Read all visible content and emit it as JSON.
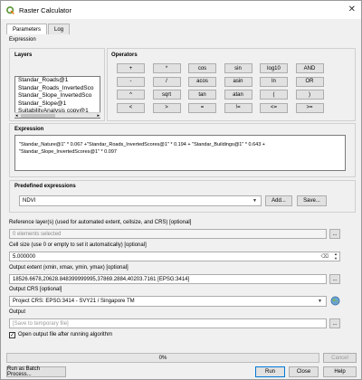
{
  "window": {
    "title": "Raster Calculator",
    "close_glyph": "✕"
  },
  "tabs": [
    {
      "label": "Parameters"
    },
    {
      "label": "Log"
    }
  ],
  "expression_header": "Expression",
  "layers": {
    "title": "Layers",
    "items": [
      "Standar_Roads@1",
      "Standar_Roads_InvertedSco",
      "Standar_Slope_InvertedSco",
      "Standar_Slope@1",
      "SuitabilityAnalysis copy@1"
    ]
  },
  "operators": {
    "title": "Operators",
    "rows": [
      [
        "+",
        "*",
        "cos",
        "sin",
        "log10",
        "AND"
      ],
      [
        "-",
        "/",
        "acos",
        "asin",
        "ln",
        "OR"
      ],
      [
        "^",
        "sqrt",
        "tan",
        "atan",
        "(",
        ")"
      ],
      [
        "<",
        ">",
        "=",
        "!=",
        "<=",
        ">="
      ]
    ]
  },
  "expression": {
    "title": "Expression",
    "text": "\"Standar_Nature@1\" * 0.067 +\"Standar_Roads_InvertedScores@1\" * 0.194 + \"Standar_Buildings@1\" * 0.643 + \"Standar_Slope_InvertedScores@1\" * 0.097"
  },
  "predefined": {
    "title": "Predefined expressions",
    "value": "NDVI",
    "add_label": "Add...",
    "save_label": "Save..."
  },
  "reference_layers": {
    "label": "Reference layer(s) (used for automated extent, cellsize, and CRS) [optional]",
    "value": "0 elements selected",
    "browse": "..."
  },
  "cell_size": {
    "label": "Cell size (use 0 or empty to set it automatically) [optional]",
    "value": "5.000000"
  },
  "output_extent": {
    "label": "Output extent (xmin, xmax, ymin, ymax) [optional]",
    "value": "18526.6678,20628.848399999995,37869.2884,40203.7161 [EPSG:3414]",
    "browse": "..."
  },
  "output_crs": {
    "label": "Output CRS [optional]",
    "value": "Project CRS: EPSG:3414 - SVY21 / Singapore TM"
  },
  "output": {
    "label": "Output",
    "placeholder": "[Save to temporary file]",
    "browse": "...",
    "open_after_label": "Open output file after running algorithm",
    "open_after_checked": true
  },
  "progress": {
    "text": "0%",
    "cancel_label": "Cancel"
  },
  "footer": {
    "batch_label": "Run as Batch Process...",
    "run_label": "Run",
    "close_label": "Close",
    "help_label": "Help"
  }
}
